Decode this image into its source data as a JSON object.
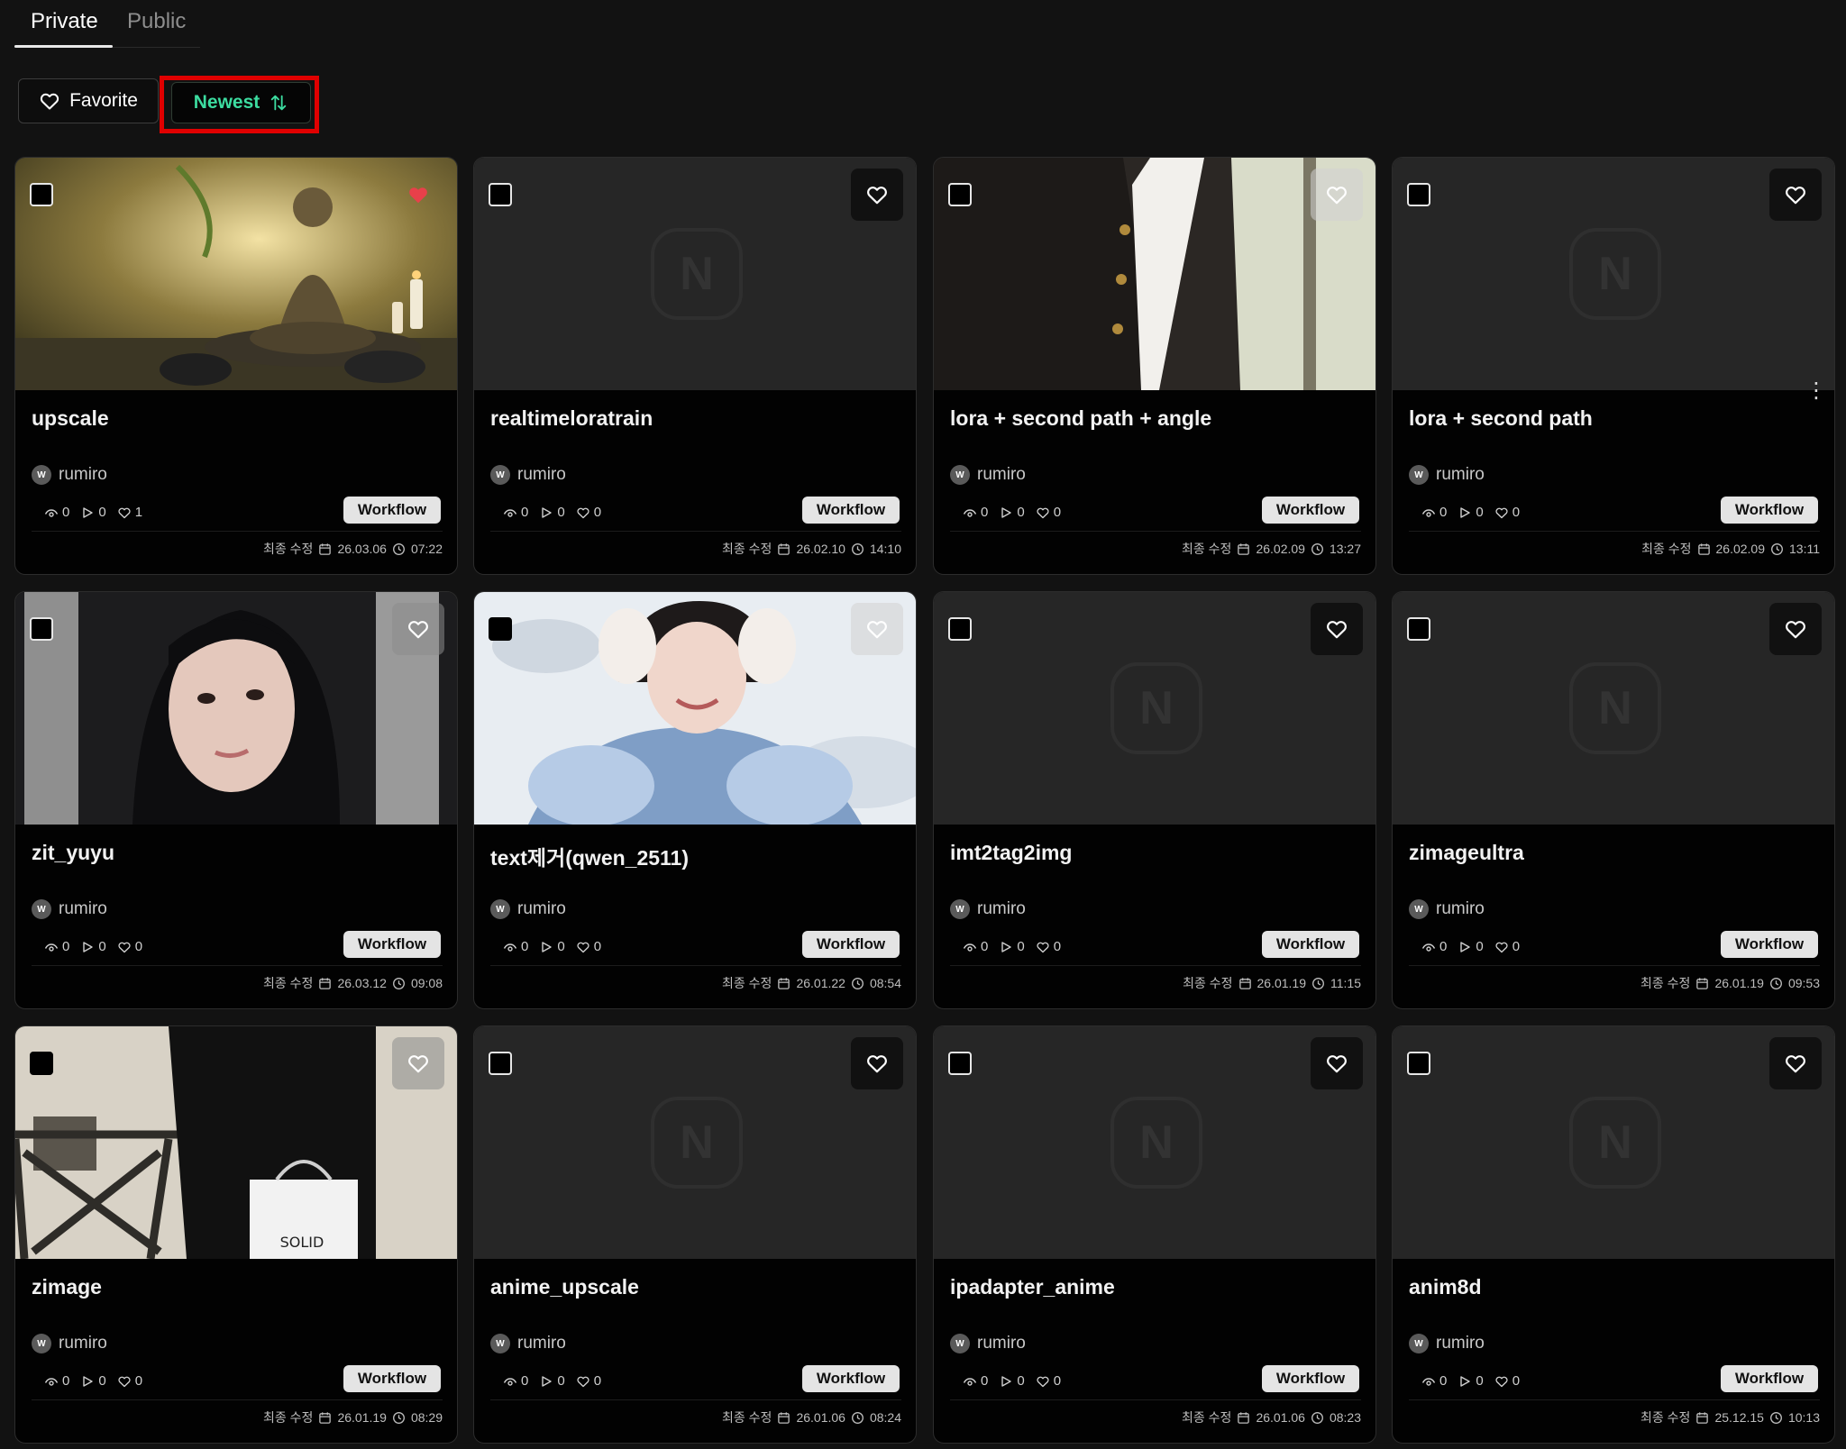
{
  "tabs": {
    "private": "Private",
    "public": "Public"
  },
  "filters": {
    "favorite": "Favorite",
    "newest": "Newest"
  },
  "colors": {
    "accent_green": "#3cdca0",
    "highlight_red": "#e00000",
    "heart_red": "#e8404a"
  },
  "meta_label": "최종 수정",
  "cards": [
    {
      "title": "upscale",
      "author": "rumiro",
      "avatar": "W",
      "views": "0",
      "runs": "0",
      "likes": "1",
      "button": "Workflow",
      "date": "26.03.06",
      "time": "07:22"
    },
    {
      "title": "realtimeloratrain",
      "author": "rumiro",
      "avatar": "W",
      "views": "0",
      "runs": "0",
      "likes": "0",
      "button": "Workflow",
      "date": "26.02.10",
      "time": "14:10"
    },
    {
      "title": "lora + second path + angle",
      "author": "rumiro",
      "avatar": "W",
      "views": "0",
      "runs": "0",
      "likes": "0",
      "button": "Workflow",
      "date": "26.02.09",
      "time": "13:27"
    },
    {
      "title": "lora + second path",
      "author": "rumiro",
      "avatar": "W",
      "views": "0",
      "runs": "0",
      "likes": "0",
      "button": "Workflow",
      "date": "26.02.09",
      "time": "13:11"
    },
    {
      "title": "zit_yuyu",
      "author": "rumiro",
      "avatar": "W",
      "views": "0",
      "runs": "0",
      "likes": "0",
      "button": "Workflow",
      "date": "26.03.12",
      "time": "09:08"
    },
    {
      "title": "text제거(qwen_2511)",
      "author": "rumiro",
      "avatar": "W",
      "views": "0",
      "runs": "0",
      "likes": "0",
      "button": "Workflow",
      "date": "26.01.22",
      "time": "08:54"
    },
    {
      "title": "imt2tag2img",
      "author": "rumiro",
      "avatar": "W",
      "views": "0",
      "runs": "0",
      "likes": "0",
      "button": "Workflow",
      "date": "26.01.19",
      "time": "11:15"
    },
    {
      "title": "zimageultra",
      "author": "rumiro",
      "avatar": "W",
      "views": "0",
      "runs": "0",
      "likes": "0",
      "button": "Workflow",
      "date": "26.01.19",
      "time": "09:53"
    },
    {
      "title": "zimage",
      "author": "rumiro",
      "avatar": "W",
      "views": "0",
      "runs": "0",
      "likes": "0",
      "button": "Workflow",
      "date": "26.01.19",
      "time": "08:29"
    },
    {
      "title": "anime_upscale",
      "author": "rumiro",
      "avatar": "W",
      "views": "0",
      "runs": "0",
      "likes": "0",
      "button": "Workflow",
      "date": "26.01.06",
      "time": "08:24"
    },
    {
      "title": "ipadapter_anime",
      "author": "rumiro",
      "avatar": "W",
      "views": "0",
      "runs": "0",
      "likes": "0",
      "button": "Workflow",
      "date": "26.01.06",
      "time": "08:23"
    },
    {
      "title": "anim8d",
      "author": "rumiro",
      "avatar": "W",
      "views": "0",
      "runs": "0",
      "likes": "0",
      "button": "Workflow",
      "date": "25.12.15",
      "time": "10:13"
    }
  ]
}
